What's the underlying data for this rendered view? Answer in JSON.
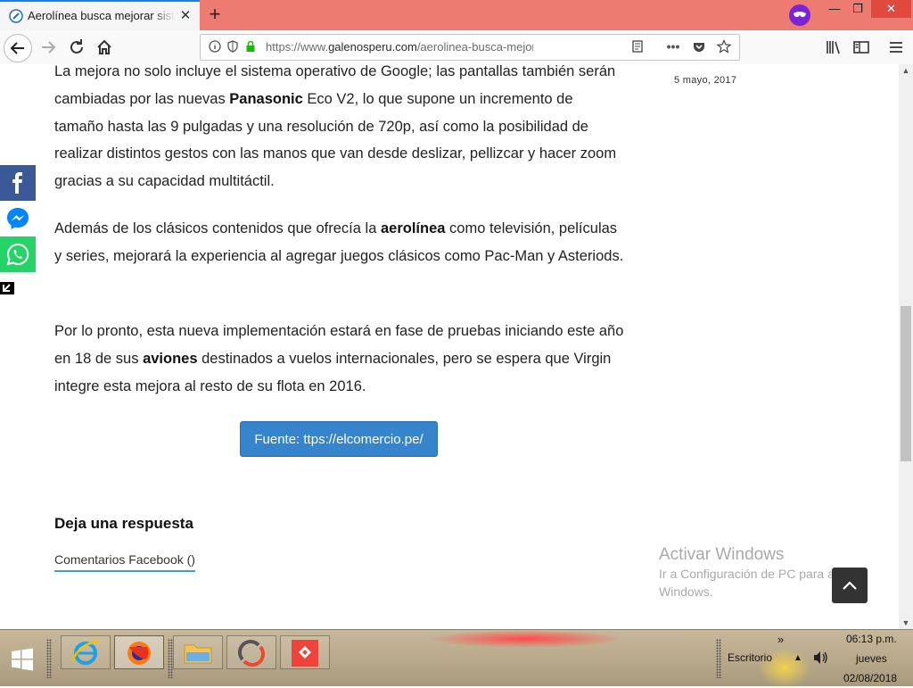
{
  "browser": {
    "tab": {
      "title": "Aerolínea busca mejorar sistem",
      "close_label": "✕"
    },
    "new_tab_label": "+",
    "window_controls": {
      "minimize": "—",
      "restore": "❐",
      "close": "✕"
    },
    "url": {
      "scheme": "https://www.",
      "host": "galenosperu.com",
      "path": "/aerolinea-busca-mejorar-siste"
    }
  },
  "article": {
    "p1_pre": "La mejora no solo incluye el sistema operativo de Google; las pantallas también serán cambiadas por las nuevas ",
    "p1_bold": "Panasonic",
    "p1_post": " Eco V2, lo que supone un incremento de tamaño hasta las 9 pulgadas y una resolución de 720p, así como la posibilidad de realizar distintos gestos con las manos que van desde deslizar, pellizcar y hacer zoom gracias a su capacidad multitáctil.",
    "p2_pre": "Además de los clásicos contenidos que ofrecía la ",
    "p2_bold": "aerolínea",
    "p2_post": " como televisión, películas y series, mejorará la experiencia al agregar juegos clásicos como Pac-Man y Asteriods.",
    "p3_pre": "Por lo pronto, esta nueva implementación estará en fase de pruebas iniciando este año en 18 de sus ",
    "p3_bold": "aviones",
    "p3_post": " destinados a vuelos internacionales, pero se espera que Virgin integre esta mejora al resto de su flota en 2016.",
    "source_button": "Fuente: ttps://elcomercio.pe/"
  },
  "comments": {
    "title": "Deja una respuesta",
    "facebook_tab": "Comentarios Facebook ()"
  },
  "sidebar": {
    "date": "5 mayo, 2017"
  },
  "watermark": {
    "title": "Activar Windows",
    "subtitle": "Ir a Configuración de PC para activar Windows."
  },
  "taskbar": {
    "desktop_label": "Escritorio",
    "chevron": "»",
    "time": "06:13 p.m.",
    "day": "jueves",
    "date": "02/08/2018"
  },
  "colors": {
    "tabbar": "#ee7b72",
    "facebook": "#3b5998",
    "messenger": "#0084ff",
    "whatsapp": "#25d366",
    "button": "#3685cc"
  }
}
